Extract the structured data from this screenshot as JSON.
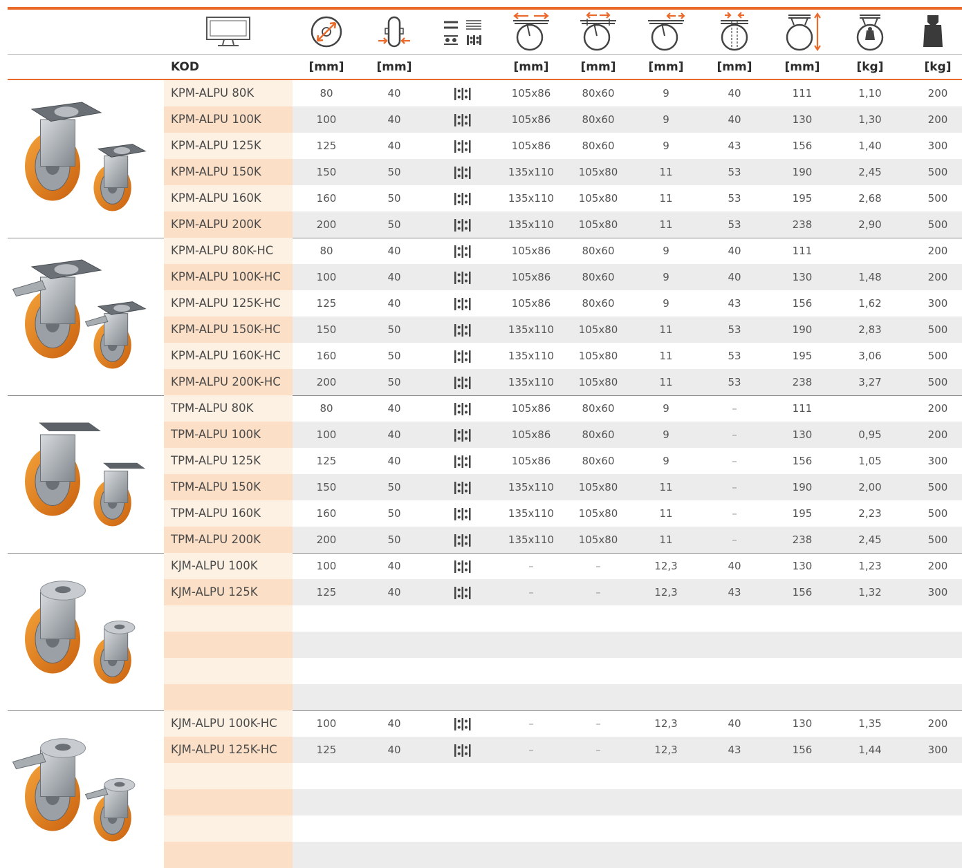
{
  "columns": {
    "kod_label": "KOD",
    "units": [
      "[mm]",
      "[mm]",
      "",
      "[mm]",
      "[mm]",
      "[mm]",
      "[mm]",
      "[mm]",
      "[kg]",
      "[kg]"
    ],
    "icons": [
      "monitor-icon",
      "wheel-diameter-icon",
      "wheel-width-icon",
      "bearing-type-icon",
      "plate-size-icon",
      "hole-spacing-icon",
      "bolt-hole-icon",
      "offset-icon",
      "overall-height-icon",
      "caster-weight-icon",
      "load-capacity-icon"
    ]
  },
  "colors": {
    "accent": "#ea6a2b",
    "code_bg_light": "#fdf1e3",
    "code_bg_dark": "#fbdfc6",
    "row_gray": "#ececec"
  },
  "groups": [
    {
      "product_icon": "swivel-caster-image",
      "rows": [
        {
          "code": "KPM-ALPU 80K",
          "d": "80",
          "w": "40",
          "bearing": "ball-bearing-icon",
          "plate": "105x86",
          "holes": "80x60",
          "bolt": "9",
          "offset": "40",
          "height": "111",
          "weight": "1,10",
          "load": "200"
        },
        {
          "code": "KPM-ALPU 100K",
          "d": "100",
          "w": "40",
          "bearing": "ball-bearing-icon",
          "plate": "105x86",
          "holes": "80x60",
          "bolt": "9",
          "offset": "40",
          "height": "130",
          "weight": "1,30",
          "load": "200"
        },
        {
          "code": "KPM-ALPU 125K",
          "d": "125",
          "w": "40",
          "bearing": "ball-bearing-icon",
          "plate": "105x86",
          "holes": "80x60",
          "bolt": "9",
          "offset": "43",
          "height": "156",
          "weight": "1,40",
          "load": "300"
        },
        {
          "code": "KPM-ALPU 150K",
          "d": "150",
          "w": "50",
          "bearing": "ball-bearing-icon",
          "plate": "135x110",
          "holes": "105x80",
          "bolt": "11",
          "offset": "53",
          "height": "190",
          "weight": "2,45",
          "load": "500"
        },
        {
          "code": "KPM-ALPU 160K",
          "d": "160",
          "w": "50",
          "bearing": "ball-bearing-icon",
          "plate": "135x110",
          "holes": "105x80",
          "bolt": "11",
          "offset": "53",
          "height": "195",
          "weight": "2,68",
          "load": "500"
        },
        {
          "code": "KPM-ALPU 200K",
          "d": "200",
          "w": "50",
          "bearing": "ball-bearing-icon",
          "plate": "135x110",
          "holes": "105x80",
          "bolt": "11",
          "offset": "53",
          "height": "238",
          "weight": "2,90",
          "load": "500"
        }
      ]
    },
    {
      "product_icon": "swivel-caster-brake-image",
      "rows": [
        {
          "code": "KPM-ALPU 80K-HC",
          "d": "80",
          "w": "40",
          "bearing": "ball-bearing-icon",
          "plate": "105x86",
          "holes": "80x60",
          "bolt": "9",
          "offset": "40",
          "height": "111",
          "weight": "",
          "load": "200"
        },
        {
          "code": "KPM-ALPU 100K-HC",
          "d": "100",
          "w": "40",
          "bearing": "ball-bearing-icon",
          "plate": "105x86",
          "holes": "80x60",
          "bolt": "9",
          "offset": "40",
          "height": "130",
          "weight": "1,48",
          "load": "200"
        },
        {
          "code": "KPM-ALPU 125K-HC",
          "d": "125",
          "w": "40",
          "bearing": "ball-bearing-icon",
          "plate": "105x86",
          "holes": "80x60",
          "bolt": "9",
          "offset": "43",
          "height": "156",
          "weight": "1,62",
          "load": "300"
        },
        {
          "code": "KPM-ALPU 150K-HC",
          "d": "150",
          "w": "50",
          "bearing": "ball-bearing-icon",
          "plate": "135x110",
          "holes": "105x80",
          "bolt": "11",
          "offset": "53",
          "height": "190",
          "weight": "2,83",
          "load": "500"
        },
        {
          "code": "KPM-ALPU 160K-HC",
          "d": "160",
          "w": "50",
          "bearing": "ball-bearing-icon",
          "plate": "135x110",
          "holes": "105x80",
          "bolt": "11",
          "offset": "53",
          "height": "195",
          "weight": "3,06",
          "load": "500"
        },
        {
          "code": "KPM-ALPU 200K-HC",
          "d": "200",
          "w": "50",
          "bearing": "ball-bearing-icon",
          "plate": "135x110",
          "holes": "105x80",
          "bolt": "11",
          "offset": "53",
          "height": "238",
          "weight": "3,27",
          "load": "500"
        }
      ]
    },
    {
      "product_icon": "fixed-caster-image",
      "rows": [
        {
          "code": "TPM-ALPU 80K",
          "d": "80",
          "w": "40",
          "bearing": "ball-bearing-icon",
          "plate": "105x86",
          "holes": "80x60",
          "bolt": "9",
          "offset": "–",
          "height": "111",
          "weight": "",
          "load": "200"
        },
        {
          "code": "TPM-ALPU 100K",
          "d": "100",
          "w": "40",
          "bearing": "ball-bearing-icon",
          "plate": "105x86",
          "holes": "80x60",
          "bolt": "9",
          "offset": "–",
          "height": "130",
          "weight": "0,95",
          "load": "200"
        },
        {
          "code": "TPM-ALPU 125K",
          "d": "125",
          "w": "40",
          "bearing": "ball-bearing-icon",
          "plate": "105x86",
          "holes": "80x60",
          "bolt": "9",
          "offset": "–",
          "height": "156",
          "weight": "1,05",
          "load": "300"
        },
        {
          "code": "TPM-ALPU 150K",
          "d": "150",
          "w": "50",
          "bearing": "ball-bearing-icon",
          "plate": "135x110",
          "holes": "105x80",
          "bolt": "11",
          "offset": "–",
          "height": "190",
          "weight": "2,00",
          "load": "500"
        },
        {
          "code": "TPM-ALPU 160K",
          "d": "160",
          "w": "50",
          "bearing": "ball-bearing-icon",
          "plate": "135x110",
          "holes": "105x80",
          "bolt": "11",
          "offset": "–",
          "height": "195",
          "weight": "2,23",
          "load": "500"
        },
        {
          "code": "TPM-ALPU 200K",
          "d": "200",
          "w": "50",
          "bearing": "ball-bearing-icon",
          "plate": "135x110",
          "holes": "105x80",
          "bolt": "11",
          "offset": "–",
          "height": "238",
          "weight": "2,45",
          "load": "500"
        }
      ]
    },
    {
      "product_icon": "bolt-hole-caster-image",
      "rows": [
        {
          "code": "KJM-ALPU 100K",
          "d": "100",
          "w": "40",
          "bearing": "ball-bearing-icon",
          "plate": "–",
          "holes": "–",
          "bolt": "12,3",
          "offset": "40",
          "height": "130",
          "weight": "1,23",
          "load": "200"
        },
        {
          "code": "KJM-ALPU 125K",
          "d": "125",
          "w": "40",
          "bearing": "ball-bearing-icon",
          "plate": "–",
          "holes": "–",
          "bolt": "12,3",
          "offset": "43",
          "height": "156",
          "weight": "1,32",
          "load": "300"
        },
        {
          "code": "",
          "d": "",
          "w": "",
          "bearing": "",
          "plate": "",
          "holes": "",
          "bolt": "",
          "offset": "",
          "height": "",
          "weight": "",
          "load": ""
        },
        {
          "code": "",
          "d": "",
          "w": "",
          "bearing": "",
          "plate": "",
          "holes": "",
          "bolt": "",
          "offset": "",
          "height": "",
          "weight": "",
          "load": ""
        },
        {
          "code": "",
          "d": "",
          "w": "",
          "bearing": "",
          "plate": "",
          "holes": "",
          "bolt": "",
          "offset": "",
          "height": "",
          "weight": "",
          "load": ""
        },
        {
          "code": "",
          "d": "",
          "w": "",
          "bearing": "",
          "plate": "",
          "holes": "",
          "bolt": "",
          "offset": "",
          "height": "",
          "weight": "",
          "load": ""
        }
      ]
    },
    {
      "product_icon": "bolt-hole-caster-brake-image",
      "rows": [
        {
          "code": "KJM-ALPU 100K-HC",
          "d": "100",
          "w": "40",
          "bearing": "ball-bearing-icon",
          "plate": "–",
          "holes": "–",
          "bolt": "12,3",
          "offset": "40",
          "height": "130",
          "weight": "1,35",
          "load": "200"
        },
        {
          "code": "KJM-ALPU 125K-HC",
          "d": "125",
          "w": "40",
          "bearing": "ball-bearing-icon",
          "plate": "–",
          "holes": "–",
          "bolt": "12,3",
          "offset": "43",
          "height": "156",
          "weight": "1,44",
          "load": "300"
        },
        {
          "code": "",
          "d": "",
          "w": "",
          "bearing": "",
          "plate": "",
          "holes": "",
          "bolt": "",
          "offset": "",
          "height": "",
          "weight": "",
          "load": ""
        },
        {
          "code": "",
          "d": "",
          "w": "",
          "bearing": "",
          "plate": "",
          "holes": "",
          "bolt": "",
          "offset": "",
          "height": "",
          "weight": "",
          "load": ""
        },
        {
          "code": "",
          "d": "",
          "w": "",
          "bearing": "",
          "plate": "",
          "holes": "",
          "bolt": "",
          "offset": "",
          "height": "",
          "weight": "",
          "load": ""
        },
        {
          "code": "",
          "d": "",
          "w": "",
          "bearing": "",
          "plate": "",
          "holes": "",
          "bolt": "",
          "offset": "",
          "height": "",
          "weight": "",
          "load": ""
        }
      ]
    }
  ]
}
